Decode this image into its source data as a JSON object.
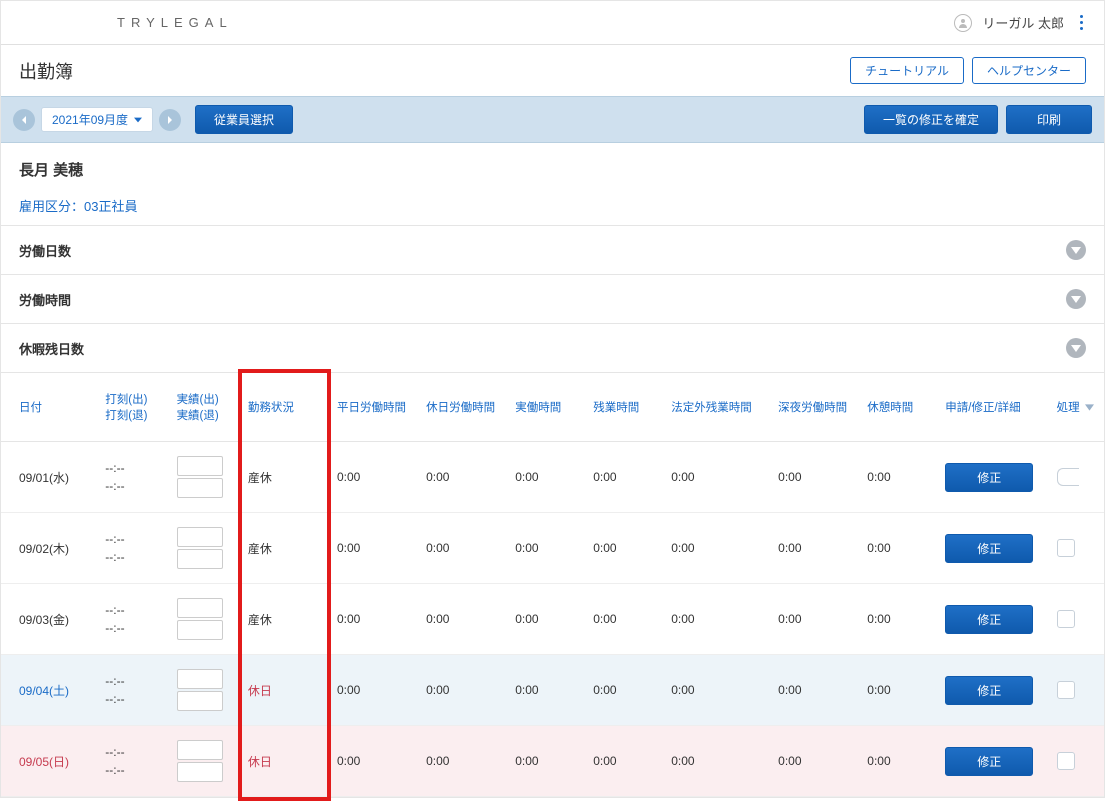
{
  "header": {
    "brand": "TRYLEGAL",
    "user": "リーガル 太郎"
  },
  "page": {
    "title": "出勤簿",
    "tutorial_btn": "チュートリアル",
    "help_btn": "ヘルプセンター"
  },
  "toolbar": {
    "month": "2021年09月度",
    "select_emp_btn": "従業員選択",
    "confirm_btn": "一覧の修正を確定",
    "print_btn": "印刷"
  },
  "employee": {
    "name": "長月 美穂",
    "class_label": "雇用区分：03正社員"
  },
  "accordions": {
    "work_days": "労働日数",
    "work_hours": "労働時間",
    "leave_remaining": "休暇残日数"
  },
  "thead": {
    "date": "日付",
    "stamp_in": "打刻(出)",
    "stamp_out": "打刻(退)",
    "actual_in": "実績(出)",
    "actual_out": "実績(退)",
    "status": "勤務状況",
    "weekday_hours": "平日労働時間",
    "holiday_hours": "休日労働時間",
    "actual_hours": "実働時間",
    "overtime": "残業時間",
    "legal_overtime": "法定外残業時間",
    "midnight": "深夜労働時間",
    "break": "休憩時間",
    "edit": "申請/修正/詳細",
    "proc": "処理"
  },
  "rows": [
    {
      "date": "09/01(水)",
      "stamp": "--:--",
      "status": "産休",
      "weekday": "0:00",
      "holiday": "0:00",
      "actual": "0:00",
      "ot": "0:00",
      "lot": "0:00",
      "mid": "0:00",
      "brk": "0:00",
      "type": ""
    },
    {
      "date": "09/02(木)",
      "stamp": "--:--",
      "status": "産休",
      "weekday": "0:00",
      "holiday": "0:00",
      "actual": "0:00",
      "ot": "0:00",
      "lot": "0:00",
      "mid": "0:00",
      "brk": "0:00",
      "type": ""
    },
    {
      "date": "09/03(金)",
      "stamp": "--:--",
      "status": "産休",
      "weekday": "0:00",
      "holiday": "0:00",
      "actual": "0:00",
      "ot": "0:00",
      "lot": "0:00",
      "mid": "0:00",
      "brk": "0:00",
      "type": ""
    },
    {
      "date": "09/04(土)",
      "stamp": "--:--",
      "status": "休日",
      "weekday": "0:00",
      "holiday": "0:00",
      "actual": "0:00",
      "ot": "0:00",
      "lot": "0:00",
      "mid": "0:00",
      "brk": "0:00",
      "type": "sat"
    },
    {
      "date": "09/05(日)",
      "stamp": "--:--",
      "status": "休日",
      "weekday": "0:00",
      "holiday": "0:00",
      "actual": "0:00",
      "ot": "0:00",
      "lot": "0:00",
      "mid": "0:00",
      "brk": "0:00",
      "type": "sun"
    }
  ],
  "labels": {
    "edit_btn": "修正"
  }
}
